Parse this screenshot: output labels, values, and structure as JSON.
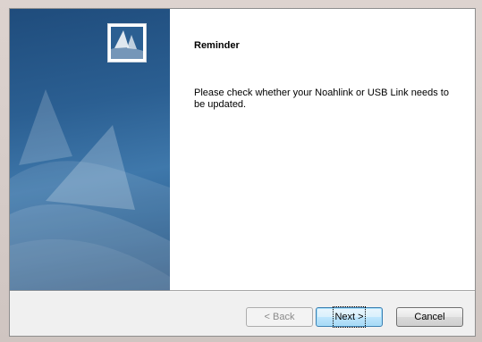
{
  "dialog": {
    "heading": "Reminder",
    "message": "Please check whether your Noahlink or USB Link needs to be updated."
  },
  "buttons": {
    "back_label": "< Back",
    "next_label": "Next >",
    "cancel_label": "Cancel"
  },
  "icons": {
    "banner": "sail-graphic-icon",
    "logo": "sail-logo-icon"
  },
  "colors": {
    "banner_dark": "#1f4c7c",
    "banner_light": "#3f78ab",
    "footer_bg": "#f0f0f0",
    "accent_button": "#3c7fb1"
  }
}
